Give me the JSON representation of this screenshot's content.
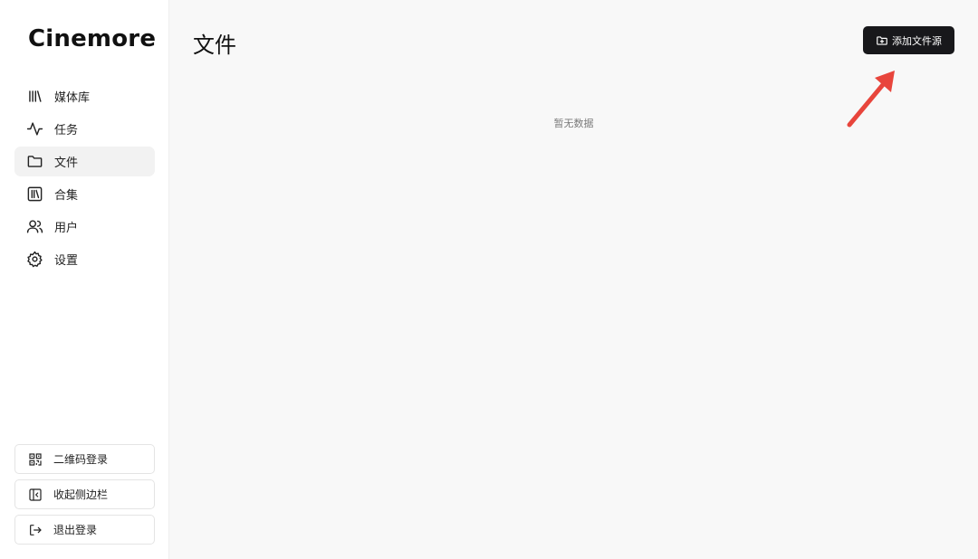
{
  "app": {
    "logo": "Cinemore"
  },
  "sidebar": {
    "items": [
      {
        "label": "媒体库",
        "icon": "library-icon",
        "active": false
      },
      {
        "label": "任务",
        "icon": "activity-icon",
        "active": false
      },
      {
        "label": "文件",
        "icon": "folder-icon",
        "active": true
      },
      {
        "label": "合集",
        "icon": "collection-icon",
        "active": false
      },
      {
        "label": "用户",
        "icon": "users-icon",
        "active": false
      },
      {
        "label": "设置",
        "icon": "gear-icon",
        "active": false
      }
    ],
    "bottom": [
      {
        "label": "二维码登录",
        "icon": "qr-code-icon"
      },
      {
        "label": "收起侧边栏",
        "icon": "collapse-sidebar-icon"
      },
      {
        "label": "退出登录",
        "icon": "logout-icon"
      }
    ]
  },
  "main": {
    "title": "文件",
    "add_button_label": "添加文件源",
    "add_button_icon": "folder-plus-icon",
    "empty_text": "暂无数据"
  },
  "colors": {
    "sidebar_bg": "#ffffff",
    "main_bg": "#f8f8f8",
    "active_item_bg": "#f2f2f2",
    "primary_button": "#18181b",
    "annotation_arrow": "#e8453c"
  }
}
